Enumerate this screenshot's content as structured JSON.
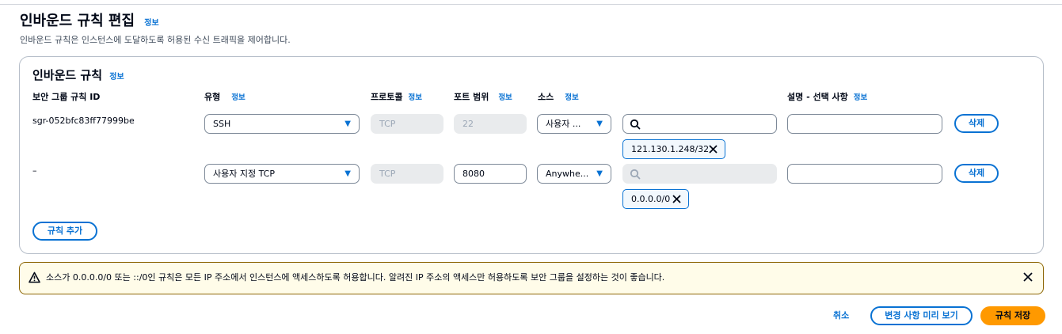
{
  "page": {
    "title": "인바운드 규칙 편집",
    "info": "정보",
    "description": "인바운드 규칙은 인스턴스에 도달하도록 허용된 수신 트래픽을 제어합니다."
  },
  "panel": {
    "title": "인바운드 규칙",
    "info": "정보",
    "columns": {
      "rule_id": "보안 그룹 규칙 ID",
      "type": "유형",
      "type_info": "정보",
      "protocol": "프로토콜",
      "protocol_info": "정보",
      "port_range": "포트 범위",
      "port_info": "정보",
      "source": "소스",
      "source_info": "정보",
      "description": "설명 - 선택 사항",
      "description_info": "정보"
    },
    "rules": [
      {
        "rule_id": "sgr-052bfc83ff77999be",
        "type": "SSH",
        "protocol": "TCP",
        "port": "22",
        "source": "사용자 ...",
        "search_value": "",
        "token": "121.130.1.248/32",
        "description": "",
        "delete_label": "삭제"
      },
      {
        "rule_id": "–",
        "type": "사용자 지정 TCP",
        "protocol": "TCP",
        "port": "8080",
        "source": "Anywhe...",
        "search_value": "",
        "token": "0.0.0.0/0",
        "description": "",
        "delete_label": "삭제"
      }
    ],
    "add_rule_label": "규칙 추가"
  },
  "alert": {
    "text": "소스가 0.0.0.0/0 또는 ::/0인 규칙은 모든 IP 주소에서 인스턴스에 액세스하도록 허용합니다. 알려진 IP 주소의 액세스만 허용하도록 보안 그룹을 설정하는 것이 좋습니다.",
    "icon": "warning-icon",
    "close_icon": "close-icon"
  },
  "footer": {
    "cancel_label": "취소",
    "preview_label": "변경 사항 미리 보기",
    "save_label": "규칙 저장"
  },
  "colors": {
    "accent": "#0972d3",
    "primary_button": "#ff9900",
    "warning_border": "#8d6605",
    "warning_bg": "#fffce9"
  }
}
